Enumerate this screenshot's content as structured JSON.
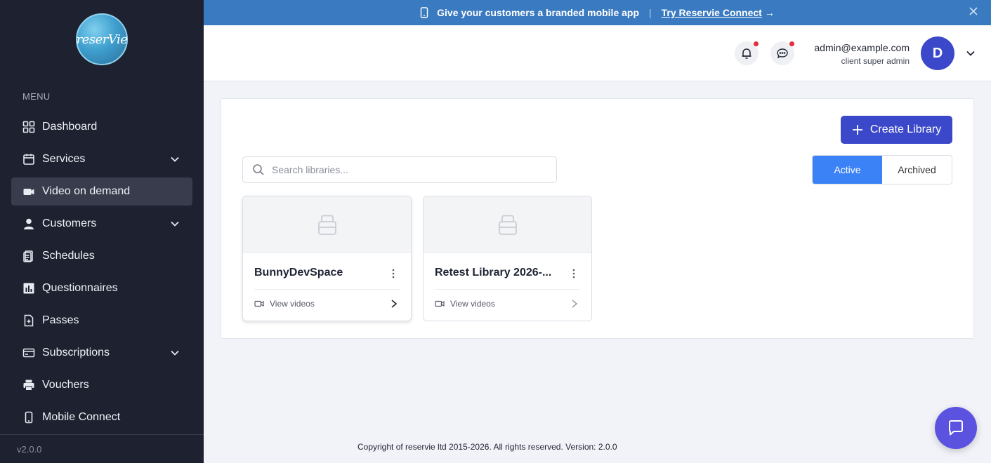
{
  "sidebar": {
    "logo_text": "reserVie",
    "menu_heading": "MENU",
    "items": [
      {
        "label": "Dashboard",
        "icon": "grid-icon"
      },
      {
        "label": "Services",
        "icon": "calendar-icon"
      },
      {
        "label": "Video on demand",
        "icon": "video-icon"
      },
      {
        "label": "Customers",
        "icon": "user-icon"
      },
      {
        "label": "Schedules",
        "icon": "clipboard-icon"
      },
      {
        "label": "Questionnaires",
        "icon": "bar-chart-icon"
      },
      {
        "label": "Passes",
        "icon": "document-icon"
      },
      {
        "label": "Subscriptions",
        "icon": "card-icon"
      },
      {
        "label": "Vouchers",
        "icon": "printer-icon"
      },
      {
        "label": "Mobile Connect",
        "icon": "mobile-icon"
      }
    ],
    "version": "v2.0.0"
  },
  "banner": {
    "text": "Give your customers a branded mobile app",
    "separator": "|",
    "link": "Try Reservie Connect",
    "arrow": "→"
  },
  "header": {
    "user_email": "admin@example.com",
    "user_role": "client super admin",
    "avatar_initial": "D"
  },
  "panel": {
    "create_label": "Create Library",
    "search_placeholder": "Search libraries...",
    "toggle_active": "Active",
    "toggle_archived": "Archived",
    "cards": [
      {
        "title": "BunnyDevSpace",
        "link": "View videos"
      },
      {
        "title": "Retest Library 2026-...",
        "link": "View videos"
      }
    ]
  },
  "footer": {
    "text": "Copyright of reservie ltd 2015-2026. All rights reserved. Version: 2.0.0"
  },
  "colors": {
    "sidebar_bg": "#1e2130",
    "banner_bg": "#3a7ac0",
    "primary": "#3b48c9",
    "toggle_active": "#3b82f6",
    "chat_fab": "#5b52e0"
  }
}
